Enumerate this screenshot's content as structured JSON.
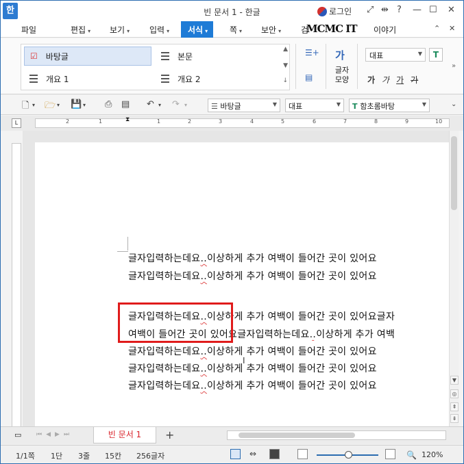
{
  "window": {
    "title": "빈 문서 1 - 한글",
    "app_icon": "한"
  },
  "login": {
    "label": "로그인"
  },
  "menus": [
    {
      "label": "파일",
      "arrow": ""
    },
    {
      "label": "편집",
      "arrow": "▾"
    },
    {
      "label": "보기",
      "arrow": "▾"
    },
    {
      "label": "입력",
      "arrow": "▾"
    },
    {
      "label": "서식",
      "arrow": "▾"
    },
    {
      "label": "쪽",
      "arrow": "▾"
    },
    {
      "label": "보안",
      "arrow": "▾"
    },
    {
      "label": "검",
      "arrow": ""
    },
    {
      "label": "이야기",
      "arrow": ""
    }
  ],
  "watermark": "MCMC IT",
  "ribbon": {
    "styles": [
      "바탕글",
      "본문",
      "개요 1",
      "개요 2"
    ],
    "char_shape_label": "글자\n모양",
    "char_shape_icon": "가",
    "font_name": "대표",
    "format_buttons": [
      "가",
      "가",
      "가",
      "가"
    ],
    "t_icon": "T"
  },
  "toolbar": {
    "style_combo": "바탕글",
    "font_lang_combo": "대표",
    "font_combo": "함초롬바탕"
  },
  "ruler": {
    "marks": [
      "2",
      "1",
      "1",
      "2",
      "3",
      "4",
      "5",
      "6",
      "7",
      "8",
      "9",
      "10"
    ]
  },
  "document": {
    "lines": [
      {
        "pre": "글자입력하는데요",
        "sq": "..",
        "post": "이상하게 추가 여백이 들어간 곳이 있어요"
      },
      {
        "pre": "글자입력하는데요",
        "sq": "..",
        "post": "이상하게 추가 여백이 들어간 곳이 있어요"
      },
      {
        "pre": "",
        "sq": "",
        "post": ""
      },
      {
        "pre": "글자입력하는데요",
        "sq": "..",
        "post": "이상하게 추가 여백이 들어간 곳이 있어요글자"
      },
      {
        "pre": "여백이 들어간 곳이 있어요글자입력하는데요",
        "sq": "..",
        "post": "이상하게 추가 여백"
      },
      {
        "pre": "글자입력하는데요",
        "sq": "..",
        "post": "이상하게 추가 여백이 들어간 곳이 있어요"
      },
      {
        "pre": "글자입력하는데요",
        "sq": "..",
        "post": "이상하게 추가 여백이 들어간 곳이 있어요"
      },
      {
        "pre": "글자입력하는데요",
        "sq": "..",
        "post": "이상하게 추가 여백이 들어간 곳이 있어요"
      }
    ]
  },
  "tabs": {
    "doc_tab": "빈 문서 1",
    "add": "+"
  },
  "status": {
    "page": "1/1쪽",
    "section": "1단",
    "line": "3줄",
    "column": "15칸",
    "chars": "256글자",
    "zoom": "120%"
  },
  "colors": {
    "accent": "#1e7bd6",
    "highlight_box": "#e01b1b",
    "tab_text": "#d9232a"
  }
}
